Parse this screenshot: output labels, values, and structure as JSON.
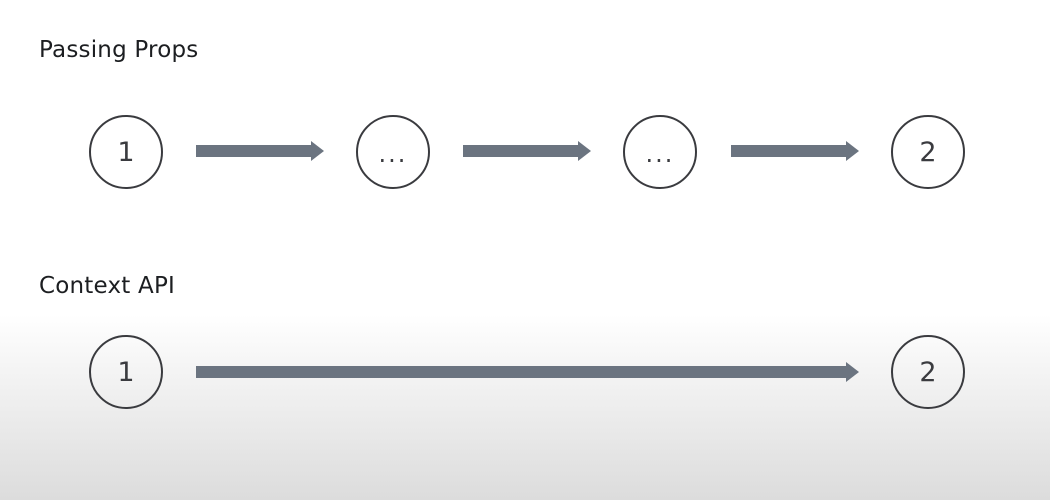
{
  "passing_props": {
    "title": "Passing Props",
    "nodes": [
      "1",
      "...",
      "...",
      "2"
    ]
  },
  "context_api": {
    "title": "Context API",
    "nodes": [
      "1",
      "2"
    ]
  },
  "colors": {
    "node_stroke": "#3a3b3f",
    "arrow": "#6b7480",
    "title_text": "#1c1e21"
  }
}
